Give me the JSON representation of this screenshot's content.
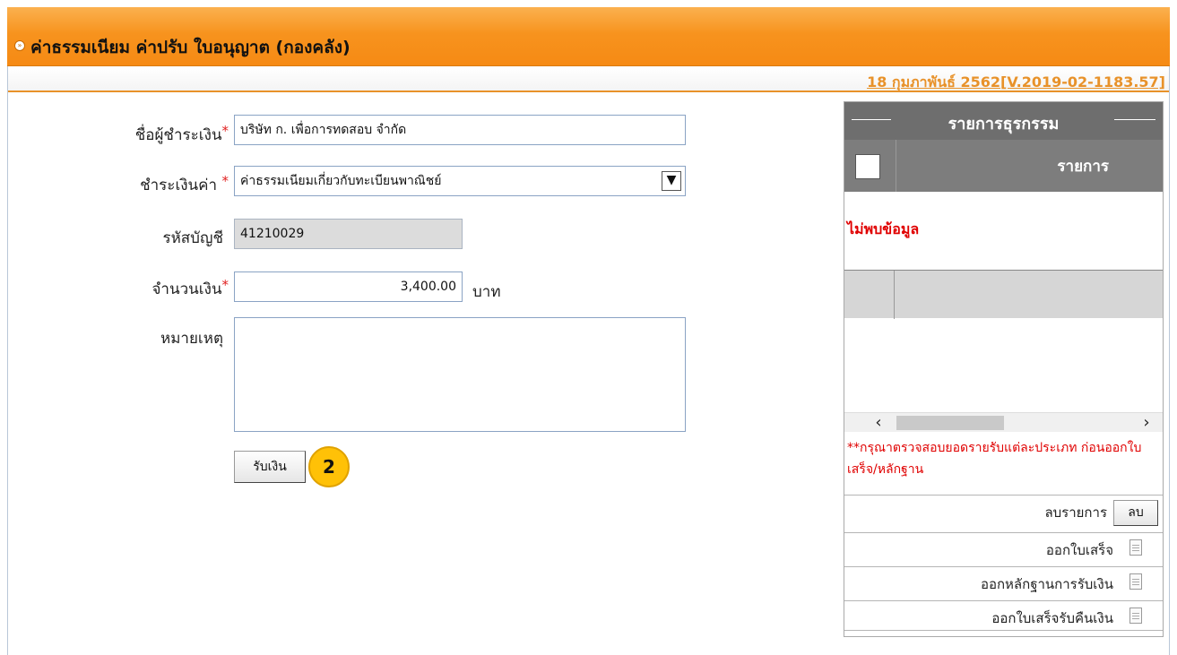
{
  "header": {
    "title": "ค่าธรรมเนียม ค่าปรับ ใบอนุญาต (กองคลัง)",
    "version": "18 กุมภาพันธ์ 2562[V.2019-02-1183.57]"
  },
  "form": {
    "payer_label": "ชื่อผู้ชำระเงิน",
    "payer_value": "บริษัท ก. เพื่อการทดสอบ จำกัด",
    "pay_for_label": "ชำระเงินค่า",
    "pay_for_value": "ค่าธรรมเนียมเกี่ยวกับทะเบียนพาณิชย์",
    "account_label": "รหัสบัญชี",
    "account_value": "41210029",
    "amount_label": "จำนวนเงิน",
    "amount_value": "3,400.00",
    "amount_unit": "บาท",
    "remark_label": "หมายเหตุ",
    "remark_value": "",
    "required_mark": "*",
    "submit_label": "รับเงิน",
    "step_badge": "2"
  },
  "panel": {
    "title": "รายการธุรกรรม",
    "column_label": "รายการ",
    "no_data": "ไม่พบข้อมูล",
    "note": "**กรุณาตรวจสอบยอดรายรับแต่ละประเภท ก่อนออกใบเสร็จ/หลักฐาน",
    "delete_label": "ลบรายการ",
    "delete_button": "ลบ",
    "actions": [
      {
        "label": "ออกใบเสร็จ",
        "icon": "document-icon"
      },
      {
        "label": "ออกหลักฐานการรับเงิน",
        "icon": "document-icon"
      },
      {
        "label": "ออกใบเสร็จรับคืนเงิน",
        "icon": "document-icon"
      }
    ]
  },
  "colors": {
    "header_orange": "#f7931e",
    "version_orange": "#e8922a",
    "required_red": "#e02020",
    "badge_yellow": "#ffc107",
    "panel_gray": "#6e6e6e"
  }
}
